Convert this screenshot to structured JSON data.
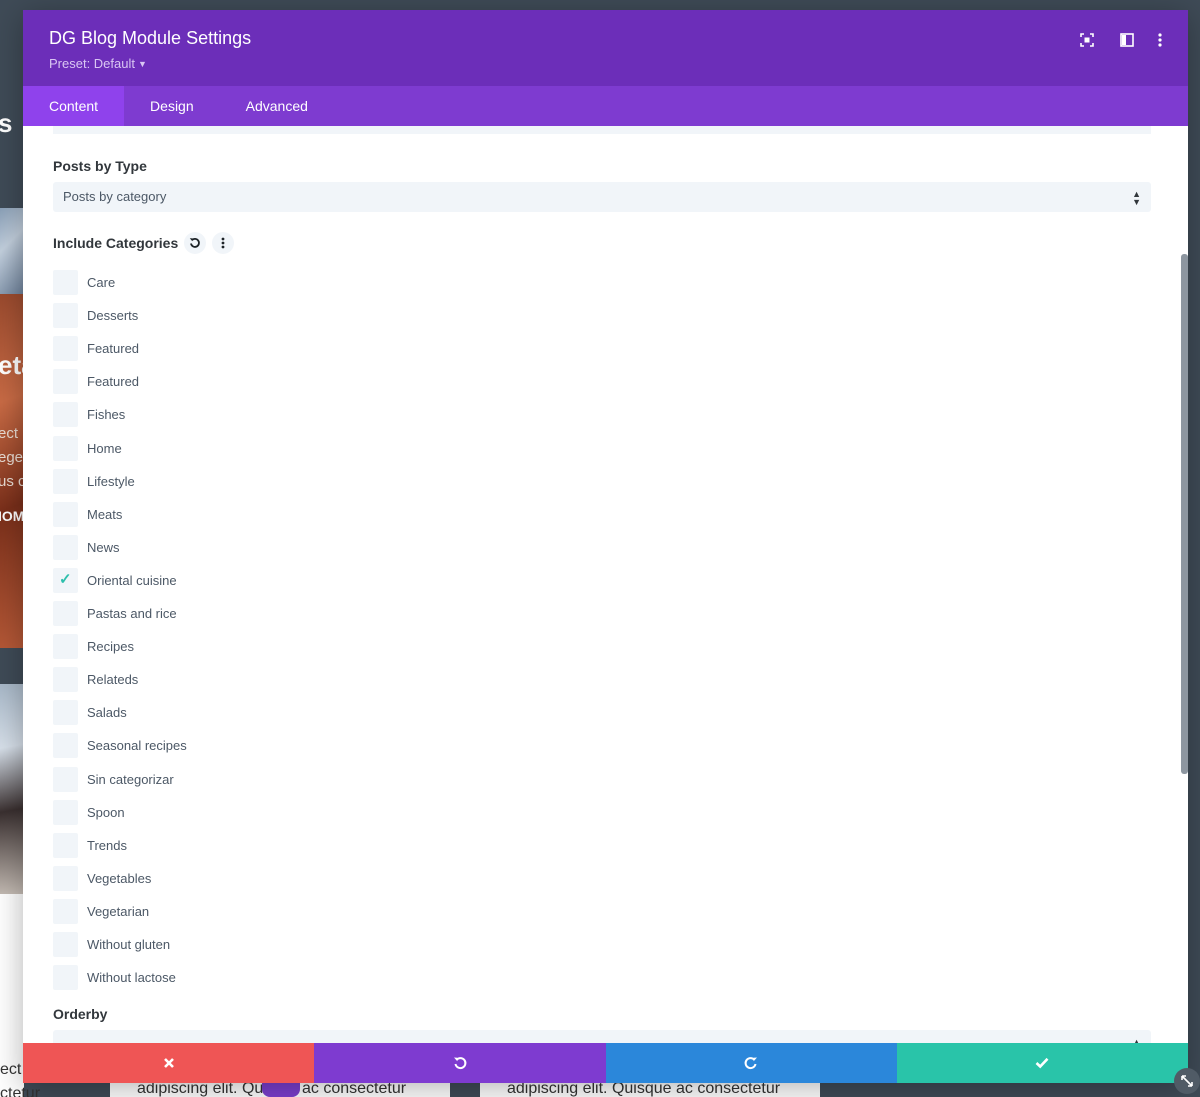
{
  "modal": {
    "title": "DG Blog Module Settings",
    "preset": "Preset: Default",
    "tabs": [
      {
        "label": "Content",
        "active": true
      },
      {
        "label": "Design",
        "active": false
      },
      {
        "label": "Advanced",
        "active": false
      }
    ]
  },
  "fields": {
    "posts_by_type": {
      "label": "Posts by Type",
      "value": "Posts by category"
    },
    "include_categories": {
      "label": "Include Categories",
      "items": [
        {
          "label": "Care",
          "checked": false
        },
        {
          "label": "Desserts",
          "checked": false
        },
        {
          "label": "Featured",
          "checked": false
        },
        {
          "label": "Featured",
          "checked": false
        },
        {
          "label": "Fishes",
          "checked": false
        },
        {
          "label": "Home",
          "checked": false
        },
        {
          "label": "Lifestyle",
          "checked": false
        },
        {
          "label": "Meats",
          "checked": false
        },
        {
          "label": "News",
          "checked": false
        },
        {
          "label": "Oriental cuisine",
          "checked": true
        },
        {
          "label": "Pastas and rice",
          "checked": false
        },
        {
          "label": "Recipes",
          "checked": false
        },
        {
          "label": "Relateds",
          "checked": false
        },
        {
          "label": "Salads",
          "checked": false
        },
        {
          "label": "Seasonal recipes",
          "checked": false
        },
        {
          "label": "Sin categorizar",
          "checked": false
        },
        {
          "label": "Spoon",
          "checked": false
        },
        {
          "label": "Trends",
          "checked": false
        },
        {
          "label": "Vegetables",
          "checked": false
        },
        {
          "label": "Vegetarian",
          "checked": false
        },
        {
          "label": "Without gluten",
          "checked": false
        },
        {
          "label": "Without lactose",
          "checked": false
        }
      ]
    },
    "orderby": {
      "label": "Orderby"
    }
  },
  "background": {
    "fragment_s": "s",
    "fragment_eta": "eta",
    "fragment_lines": [
      "ect",
      "ege",
      "us c"
    ],
    "fragment_om": "IOM",
    "card_left_text": "adipiscing elit. Qui",
    "card_left_text2": "ac consectetur",
    "card_right_text": "adipiscing elit. Quisque ac consectetur",
    "left_bottom_lines": [
      "ect",
      "ctetur"
    ]
  },
  "colors": {
    "header": "#6c2eb9",
    "tabs": "#7e3bd0",
    "active_tab": "#8f42ec",
    "cancel": "#ef5555",
    "undo": "#7e3bd0",
    "redo": "#2b87da",
    "save": "#29c4a9",
    "check": "#2ebfac"
  },
  "icons": {
    "header": [
      "focus-icon",
      "split-view-icon",
      "more-vertical-icon"
    ],
    "footer": [
      "close-icon",
      "undo-icon",
      "redo-icon",
      "check-icon"
    ]
  }
}
